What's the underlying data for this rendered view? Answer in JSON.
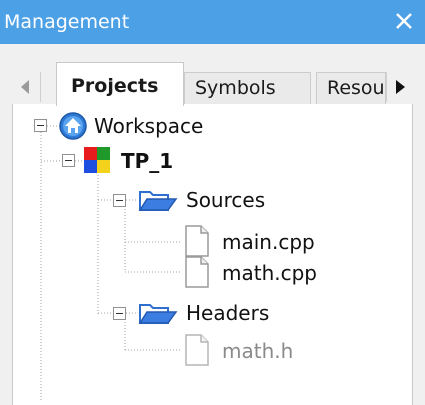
{
  "panel": {
    "title": "Management",
    "close_glyph": "X"
  },
  "tabs": [
    {
      "label": "Projects",
      "active": true
    },
    {
      "label": "Symbols",
      "active": false
    },
    {
      "label": "Resou",
      "active": false
    }
  ],
  "tree": {
    "workspace": {
      "label": "Workspace",
      "icon": "workspace-home-icon"
    },
    "project": {
      "label": "TP_1",
      "icon": "project-colored-squares-icon"
    },
    "sources": {
      "label": "Sources",
      "icon": "folder-open-icon"
    },
    "source_files": [
      {
        "label": "main.cpp",
        "icon": "file-icon"
      },
      {
        "label": "math.cpp",
        "icon": "file-icon"
      }
    ],
    "headers": {
      "label": "Headers",
      "icon": "folder-open-icon"
    },
    "header_files": [
      {
        "label": "math.h",
        "icon": "file-icon"
      }
    ]
  },
  "colors": {
    "titlebar": "#4ca0e6",
    "dim_text": "#8a8a8a",
    "folder_blue": "#2f6fd0"
  }
}
